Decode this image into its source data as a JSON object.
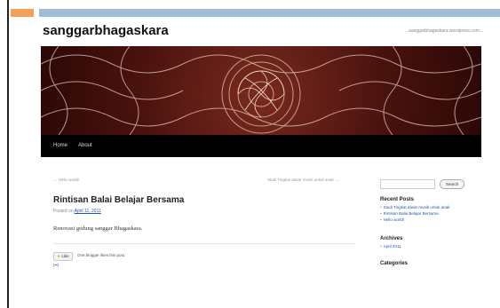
{
  "site": {
    "title": "sanggarbhagaskara",
    "tagline": "...sanggarbhagaskara.wordpress.com..."
  },
  "nav": {
    "items": [
      {
        "label": "Home"
      },
      {
        "label": "About"
      }
    ]
  },
  "post_nav": {
    "previous": "← Hello world!",
    "next": "Studi Tingkat dasar musik untuk anak →"
  },
  "post": {
    "title": "Rintisan Balai Belajar Bersama",
    "posted_prefix": "Posted on",
    "date": "April 11, 2011",
    "body": "Renovasi gedung sanggar Bhagaskara."
  },
  "likes": {
    "button_label": "Like",
    "note": "One blogger likes this post.",
    "avatar": "(••)"
  },
  "sidebar": {
    "search_placeholder": "",
    "search_button": "Search",
    "recent_posts_title": "Recent Posts",
    "recent_posts": [
      "Studi Tingkat dasar musik untuk anak",
      "Rintisan Balai Belajar Bersama",
      "Hello world!"
    ],
    "archives_title": "Archives",
    "archives": [
      "April 2011"
    ],
    "categories_title": "Categories"
  },
  "colors": {
    "slide_orange": "#f5a05a",
    "slide_blue": "#9fbcd6",
    "nav_background": "#000000",
    "link": "#1b57b1",
    "banner": "#4a120e"
  },
  "icons": {
    "like": "thumbs-up-icon",
    "banner": "ornamental-mandala-pattern"
  }
}
